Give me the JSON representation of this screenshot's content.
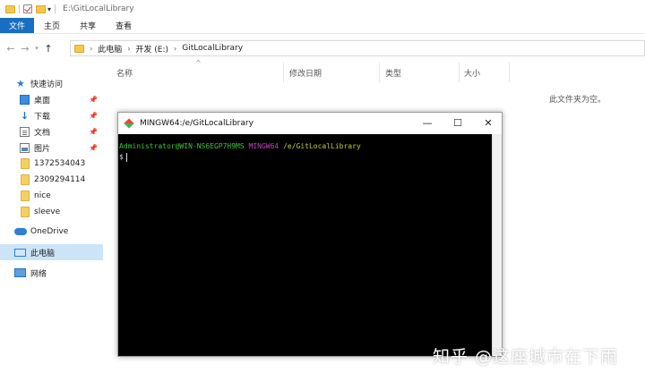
{
  "titlebar": {
    "path": "E:\\GitLocalLibrary"
  },
  "ribbon": {
    "tabs": [
      "文件",
      "主页",
      "共享",
      "查看"
    ]
  },
  "address": {
    "crumbs": [
      "此电脑",
      "开发 (E:)",
      "GitLocalLibrary"
    ]
  },
  "sidebar": {
    "quick_access": "快速访问",
    "items": [
      "桌面",
      "下载",
      "文档",
      "图片",
      "1372534043",
      "2309294114",
      "nice",
      "sleeve"
    ],
    "onedrive": "OneDrive",
    "this_pc": "此电脑",
    "network": "网络"
  },
  "columns": [
    "名称",
    "修改日期",
    "类型",
    "大小"
  ],
  "empty_message": "此文件夹为空。",
  "git_window": {
    "title": "MINGW64:/e/GitLocalLibrary",
    "prompt_user": "Administrator@WIN-NS6EGP7H9MS",
    "prompt_env": "MINGW64",
    "prompt_path": "/e/GitLocalLibrary",
    "prompt_symbol": "$"
  },
  "watermark": "知乎 @这座城市在下雨"
}
